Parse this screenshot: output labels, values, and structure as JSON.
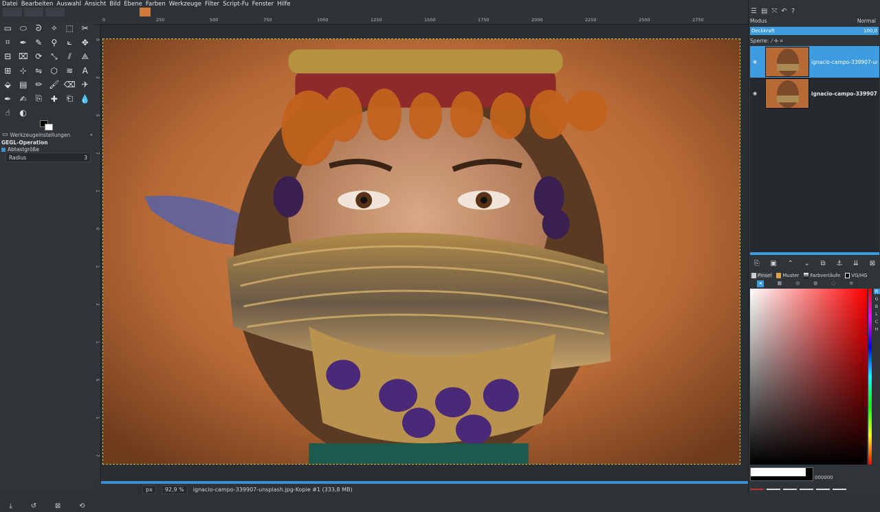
{
  "menu": [
    "Datei",
    "Bearbeiten",
    "Auswahl",
    "Ansicht",
    "Bild",
    "Ebene",
    "Farben",
    "Werkzeuge",
    "Filter",
    "Script-Fu",
    "Fenster",
    "Hilfe"
  ],
  "toolbox": {
    "tools": [
      "rect-select",
      "ellipse-select",
      "lasso",
      "fuzzy-select",
      "select-by-color",
      "scissors",
      "foreground-select",
      "paths",
      "color-picker",
      "zoom",
      "measure",
      "move",
      "align",
      "crop",
      "rotate",
      "scale",
      "shear",
      "perspective",
      "unified-transform",
      "handle-transform",
      "flip",
      "cage",
      "warp",
      "text",
      "bucket-fill",
      "blend",
      "pencil",
      "paintbrush",
      "eraser",
      "airbrush",
      "ink",
      "mypaint",
      "clone",
      "heal",
      "perspective-clone",
      "blur",
      "smudge",
      "dodge"
    ],
    "fg_color": "#000000",
    "bg_color": "#ffffff",
    "options_tab": "Werkzeugeinstellungen",
    "options_title": "GEGL-Operation",
    "sample_label": "Abtastgröße",
    "radius_label": "Radius",
    "radius_value": "3"
  },
  "rulers": {
    "top": [
      "0",
      "250",
      "500",
      "750",
      "1000",
      "1250",
      "1500",
      "1750",
      "2000",
      "2250",
      "2500",
      "2750"
    ],
    "left": [
      "0",
      "2",
      "5",
      "7",
      "1",
      "0",
      "1",
      "2",
      "1",
      "5",
      "1",
      "7"
    ]
  },
  "status": {
    "unit": "px",
    "zoom": "92,9 %",
    "info": "ignacio-campo-339907-unsplash.jpg-Kopie #1 (333,8 MB)"
  },
  "layers_panel": {
    "mode_label": "Modus",
    "mode_value": "Normal",
    "opacity_label": "Deckkraft",
    "opacity_value": "100,0",
    "lock_label": "Sperre:",
    "lock_icons": "⁄ ✛ ⌗",
    "layers": [
      {
        "name": "ignacio-campo-339907-unsplash",
        "selected": true
      },
      {
        "name": "ignacio-campo-339907-unsplash",
        "selected": false
      }
    ]
  },
  "brush_tabs": [
    "Pinsel",
    "Muster",
    "Farbverläufe",
    "VG/HG"
  ],
  "color_channels": [
    "R",
    "G",
    "B",
    "L",
    "C",
    "H"
  ],
  "hex_value": "000000",
  "colors": {
    "accent": "#3d9be0",
    "bg": "#2d3236"
  }
}
